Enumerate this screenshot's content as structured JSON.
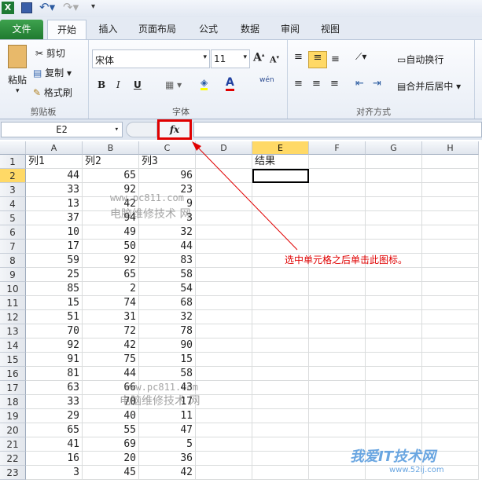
{
  "qat": {
    "icons": [
      "excel-logo-icon",
      "save-icon",
      "undo-icon",
      "redo-icon",
      "customize-icon"
    ]
  },
  "tabs": [
    {
      "label": "文件"
    },
    {
      "label": "开始"
    },
    {
      "label": "插入"
    },
    {
      "label": "页面布局"
    },
    {
      "label": "公式"
    },
    {
      "label": "数据"
    },
    {
      "label": "审阅"
    },
    {
      "label": "视图"
    }
  ],
  "active_tab": "开始",
  "ribbon": {
    "clipboard": {
      "paste": "粘贴",
      "cut": "剪切",
      "copy": "复制",
      "format_painter": "格式刷",
      "label": "剪贴板"
    },
    "font": {
      "font_name": "宋体",
      "font_size": "11",
      "bold": "B",
      "italic": "I",
      "underline": "U",
      "font_color_letter": "A",
      "label": "字体",
      "phonetic": "wén"
    },
    "alignment": {
      "wrap_text": "自动换行",
      "merge_center": "合并后居中",
      "label": "对齐方式"
    }
  },
  "formula_bar": {
    "name_box": "E2",
    "fx": "fx",
    "formula": ""
  },
  "columns": [
    "A",
    "B",
    "C",
    "D",
    "E",
    "F",
    "G",
    "H"
  ],
  "rows": [
    [
      "列1",
      "列2",
      "列3",
      "",
      "结果"
    ],
    [
      44,
      65,
      96
    ],
    [
      33,
      92,
      23
    ],
    [
      13,
      42,
      9
    ],
    [
      37,
      94,
      3
    ],
    [
      10,
      49,
      32
    ],
    [
      17,
      50,
      44
    ],
    [
      59,
      92,
      83
    ],
    [
      25,
      65,
      58
    ],
    [
      85,
      2,
      54
    ],
    [
      15,
      74,
      68
    ],
    [
      51,
      31,
      32
    ],
    [
      70,
      72,
      78
    ],
    [
      92,
      42,
      90
    ],
    [
      91,
      75,
      15
    ],
    [
      81,
      44,
      58
    ],
    [
      63,
      66,
      43
    ],
    [
      33,
      70,
      17
    ],
    [
      29,
      40,
      11
    ],
    [
      65,
      55,
      47
    ],
    [
      41,
      69,
      5
    ],
    [
      16,
      20,
      36
    ],
    [
      3,
      45,
      42
    ]
  ],
  "selected_cell": "E2",
  "annotation": {
    "text": "选中单元格之后单击此图标。",
    "color": "#e00000"
  },
  "watermarks": {
    "url": "www.pc811.com",
    "site": "电脑维修技术 网",
    "logo_text": "我爱IT技术网",
    "logo_url": "www.52ij.com"
  },
  "colors": {
    "file_tab": "#2a8a3a",
    "highlight": "#ffd966",
    "annotation": "#e00000"
  }
}
